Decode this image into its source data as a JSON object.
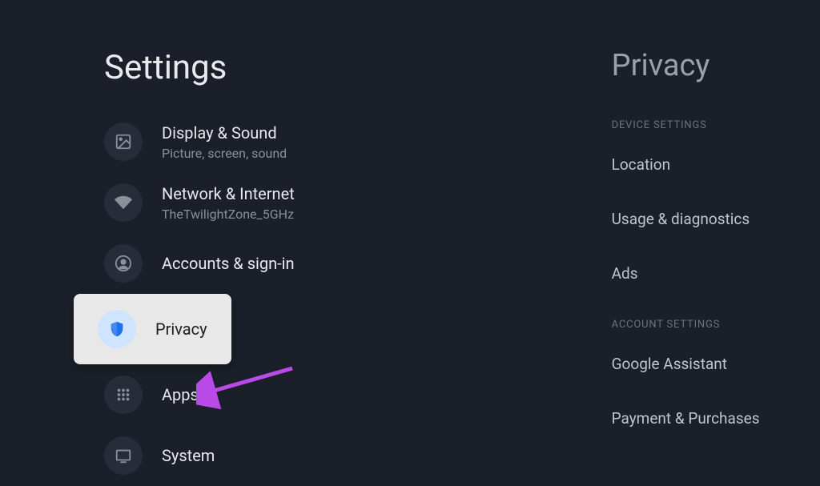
{
  "left": {
    "title": "Settings",
    "items": [
      {
        "label": "Display & Sound",
        "sublabel": "Picture, screen, sound",
        "icon": "image-icon",
        "selected": false
      },
      {
        "label": "Network & Internet",
        "sublabel": "TheTwilightZone_5GHz",
        "icon": "wifi-icon",
        "selected": false
      },
      {
        "label": "Accounts & sign-in",
        "sublabel": "",
        "icon": "account-icon",
        "selected": false
      },
      {
        "label": "Privacy",
        "sublabel": "",
        "icon": "shield-icon",
        "selected": true
      },
      {
        "label": "Apps",
        "sublabel": "",
        "icon": "apps-icon",
        "selected": false
      },
      {
        "label": "System",
        "sublabel": "",
        "icon": "tv-icon",
        "selected": false
      }
    ]
  },
  "right": {
    "title": "Privacy",
    "sections": [
      {
        "header": "DEVICE SETTINGS",
        "items": [
          "Location",
          "Usage & diagnostics",
          "Ads"
        ]
      },
      {
        "header": "ACCOUNT SETTINGS",
        "items": [
          "Google Assistant",
          "Payment & Purchases"
        ]
      }
    ]
  },
  "annotation": {
    "arrow_color": "#b94ae8"
  }
}
